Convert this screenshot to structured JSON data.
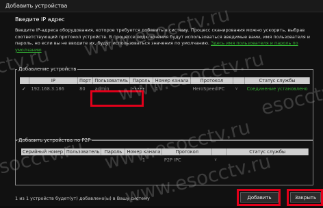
{
  "window": {
    "title": "Добавить устройства"
  },
  "intro": {
    "heading": "Введите IP адрес",
    "description": "Введите IP-адреса оборудования, которое требуется добавить в систему. Процесс сканирования можно ускорить, выбрав соответствующий протокол устройств. В процессе подключения будут использоваться введимые вами, имя пользователя и пароль, но если вы не вводите их, будут использоваться значения по умолчанию.",
    "link": "Здесь имя пользователя и пароль по умолчанию"
  },
  "ip_section": {
    "legend": "Добавление устройств",
    "columns": [
      "",
      "IP",
      "Порт",
      "Пользователь",
      "Пароль",
      "Номер канала",
      "Протокол",
      "",
      "Статус службы"
    ],
    "rows": [
      {
        "checked": "✓",
        "ip": "192.168.3.186",
        "port": "80",
        "user": "admin",
        "password": "•••••",
        "channel": "1",
        "protocol": "HeroSpeedIPC",
        "status": "Соединение установлено"
      }
    ]
  },
  "p2p_section": {
    "legend": "Добавить устройства  по P2P",
    "columns": [
      "Серийный номер",
      "Пользователь",
      "Пароль",
      "Номер канала",
      "Протокол",
      "",
      "Статус службы"
    ],
    "rows": [
      {
        "serial": "",
        "user": "",
        "password": "",
        "channel": "1",
        "protocol": "P2P IPC",
        "status": ""
      }
    ]
  },
  "footer": {
    "summary": "1 из 1 устройств будет(ут) добавлено(ы) в Вашу систему",
    "add_label": "Добавить",
    "close_label": "Закрыть"
  },
  "watermarks": [
    "www.esocctv.ru",
    "esocctv.ru",
    "www.esocctv.ru",
    "esocctv.ru",
    "www.esocctv.ru",
    "esocctv.ru",
    "www.esocctv.ru"
  ],
  "colors": {
    "accent_highlight": "#e2001a",
    "status_ok": "#2fa82f",
    "background": "#0d0d0d"
  }
}
